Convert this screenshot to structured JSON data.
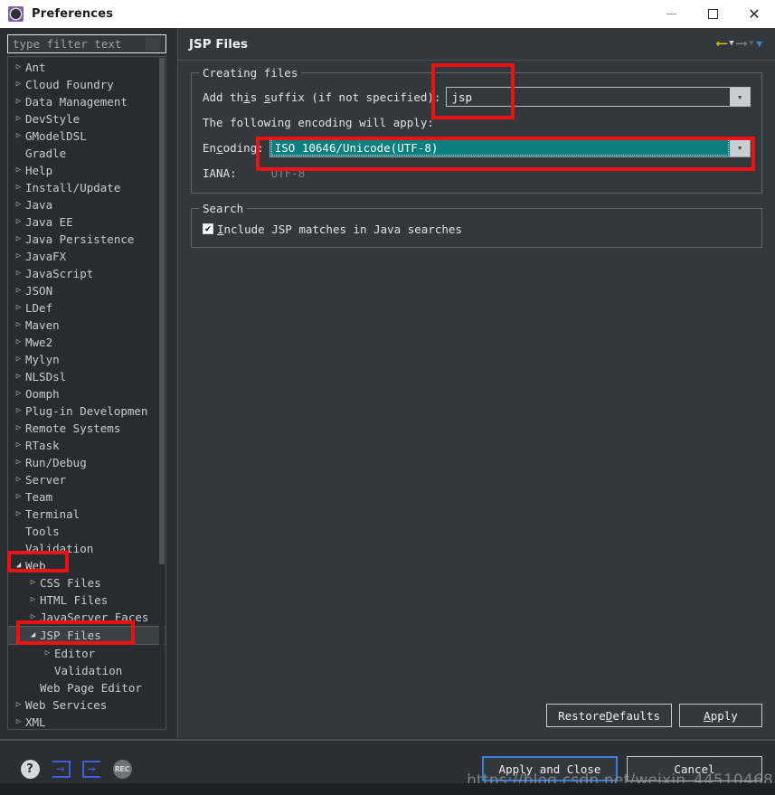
{
  "window": {
    "title": "Preferences",
    "icon": "preferences-gear-icon",
    "controls": {
      "minimize": "—",
      "maximize": "□",
      "close": "✕"
    }
  },
  "sidebar": {
    "filter": {
      "placeholder": "type filter text",
      "value": ""
    },
    "items": [
      {
        "label": "Ant",
        "depth": 0,
        "arrow": "collapsed"
      },
      {
        "label": "Cloud Foundry",
        "depth": 0,
        "arrow": "collapsed"
      },
      {
        "label": "Data Management",
        "depth": 0,
        "arrow": "collapsed"
      },
      {
        "label": "DevStyle",
        "depth": 0,
        "arrow": "collapsed"
      },
      {
        "label": "GModelDSL",
        "depth": 0,
        "arrow": "collapsed"
      },
      {
        "label": "Gradle",
        "depth": 0,
        "arrow": "none"
      },
      {
        "label": "Help",
        "depth": 0,
        "arrow": "collapsed"
      },
      {
        "label": "Install/Update",
        "depth": 0,
        "arrow": "collapsed"
      },
      {
        "label": "Java",
        "depth": 0,
        "arrow": "collapsed"
      },
      {
        "label": "Java EE",
        "depth": 0,
        "arrow": "collapsed"
      },
      {
        "label": "Java Persistence",
        "depth": 0,
        "arrow": "collapsed"
      },
      {
        "label": "JavaFX",
        "depth": 0,
        "arrow": "collapsed"
      },
      {
        "label": "JavaScript",
        "depth": 0,
        "arrow": "collapsed"
      },
      {
        "label": "JSON",
        "depth": 0,
        "arrow": "collapsed"
      },
      {
        "label": "LDef",
        "depth": 0,
        "arrow": "collapsed"
      },
      {
        "label": "Maven",
        "depth": 0,
        "arrow": "collapsed"
      },
      {
        "label": "Mwe2",
        "depth": 0,
        "arrow": "collapsed"
      },
      {
        "label": "Mylyn",
        "depth": 0,
        "arrow": "collapsed"
      },
      {
        "label": "NLSDsl",
        "depth": 0,
        "arrow": "collapsed"
      },
      {
        "label": "Oomph",
        "depth": 0,
        "arrow": "collapsed"
      },
      {
        "label": "Plug-in Developmen",
        "depth": 0,
        "arrow": "collapsed"
      },
      {
        "label": "Remote Systems",
        "depth": 0,
        "arrow": "collapsed"
      },
      {
        "label": "RTask",
        "depth": 0,
        "arrow": "collapsed"
      },
      {
        "label": "Run/Debug",
        "depth": 0,
        "arrow": "collapsed"
      },
      {
        "label": "Server",
        "depth": 0,
        "arrow": "collapsed"
      },
      {
        "label": "Team",
        "depth": 0,
        "arrow": "collapsed"
      },
      {
        "label": "Terminal",
        "depth": 0,
        "arrow": "collapsed"
      },
      {
        "label": "Tools",
        "depth": 0,
        "arrow": "none"
      },
      {
        "label": "Validation",
        "depth": 0,
        "arrow": "none"
      },
      {
        "label": "Web",
        "depth": 0,
        "arrow": "expanded"
      },
      {
        "label": "CSS Files",
        "depth": 1,
        "arrow": "collapsed"
      },
      {
        "label": "HTML Files",
        "depth": 1,
        "arrow": "collapsed"
      },
      {
        "label": "JavaServer Faces",
        "depth": 1,
        "arrow": "collapsed"
      },
      {
        "label": "JSP Files",
        "depth": 1,
        "arrow": "expanded",
        "selected": true
      },
      {
        "label": "Editor",
        "depth": 2,
        "arrow": "collapsed"
      },
      {
        "label": "Validation",
        "depth": 2,
        "arrow": "none"
      },
      {
        "label": "Web Page Editor",
        "depth": 1,
        "arrow": "none"
      },
      {
        "label": "Web Services",
        "depth": 0,
        "arrow": "collapsed"
      },
      {
        "label": "XML",
        "depth": 0,
        "arrow": "collapsed"
      }
    ]
  },
  "content": {
    "title": "JSP Files",
    "nav": {
      "back_icon": "back-arrow-icon",
      "back_menu_icon": "chevron-down-icon",
      "forward_icon": "forward-arrow-icon",
      "forward_menu_icon": "chevron-down-icon",
      "view_menu_icon": "chevron-down-icon"
    },
    "creating_files": {
      "title": "Creating files",
      "suffix_label_pre": "Add th",
      "suffix_label_mn": "i",
      "suffix_label_post": "s ",
      "suffix_label_full_pre": "Add this ",
      "suffix_label_mn2": "s",
      "suffix_label_full_post": "uffix (if not specified):",
      "suffix_value": "jsp",
      "suffix_dropdown_icon": "chevron-down-icon",
      "encoding_note": "The following encoding will apply:",
      "encoding_label_pre": "En",
      "encoding_label_mn": "c",
      "encoding_label_post": "oding:",
      "encoding_value": "ISO 10646/Unicode(UTF-8)",
      "encoding_dropdown_icon": "chevron-down-icon",
      "iana_label": "IANA:",
      "iana_value": "UTF-8"
    },
    "search": {
      "title": "Search",
      "checkbox_checked": true,
      "checkbox_mark": "✔",
      "checkbox_label_mn": "I",
      "checkbox_label_rest": "nclude JSP matches in Java searches"
    },
    "buttons": {
      "restore_pre": "Restore ",
      "restore_mn": "D",
      "restore_post": "efaults",
      "apply_pre": "",
      "apply_mn": "A",
      "apply_post": "pply"
    }
  },
  "footer": {
    "icons": [
      {
        "name": "help-icon",
        "glyph": "?"
      },
      {
        "name": "import-icon",
        "glyph": "→"
      },
      {
        "name": "export-icon",
        "glyph": "→"
      },
      {
        "name": "record-icon",
        "glyph": "REC"
      }
    ],
    "apply_and_close": "Apply and Close",
    "cancel": "Cancel"
  },
  "watermark": "https://blog.csdn.net/weixin_44510468",
  "colors": {
    "accent_blue": "#3c7ddb",
    "annotation_red": "#ee1111",
    "encoding_teal": "#0a7f7f",
    "back_arrow_yellow": "#f5c518",
    "titlebar_bg": "#ffffff",
    "panel_bg": "#33383d",
    "window_bg": "#2b2f33"
  }
}
